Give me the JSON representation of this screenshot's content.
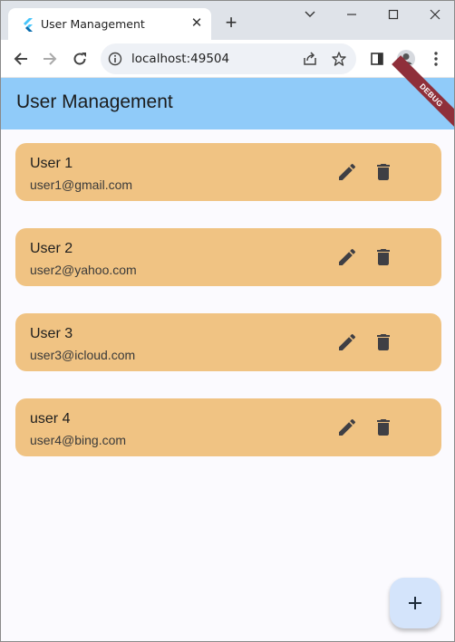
{
  "browser": {
    "tab_title": "User Management",
    "tab_close": "✕",
    "new_tab": "+",
    "url": "localhost:49504",
    "controls": {
      "minimize": "—",
      "maximize": "☐",
      "close": "✕",
      "menu": "⌄"
    }
  },
  "app": {
    "title": "User Management",
    "debug_label": "DEBUG",
    "appbar_color": "#90cbf9",
    "card_color": "#f0c383"
  },
  "users": [
    {
      "name": "User 1",
      "email": "user1@gmail.com"
    },
    {
      "name": "User 2",
      "email": "user2@yahoo.com"
    },
    {
      "name": "User 3",
      "email": "user3@icloud.com"
    },
    {
      "name": "user 4",
      "email": "user4@bing.com"
    }
  ],
  "fab": {
    "icon": "add-icon"
  }
}
